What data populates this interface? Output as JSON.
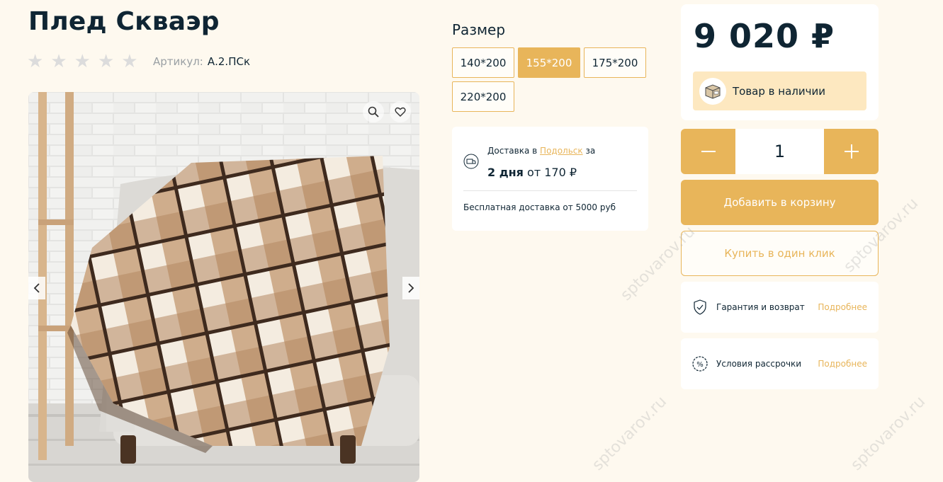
{
  "product": {
    "title": "Плед Скваэр",
    "rating_stars": 0,
    "sku_label": "Артикул:",
    "sku_value": "А.2.ПСк"
  },
  "gallery": {
    "icons": [
      "search-icon",
      "heart-icon",
      "chevron-left-icon",
      "chevron-right-icon"
    ]
  },
  "size": {
    "label": "Размер",
    "options": [
      "140*200",
      "155*200",
      "175*200",
      "220*200"
    ],
    "selected": "155*200"
  },
  "delivery": {
    "prefix": "Доставка в ",
    "city": "Подольск",
    "suffix": " за",
    "days": "2 дня",
    "from": " от 170 ₽",
    "free": "Бесплатная доставка от 5000 руб"
  },
  "price": {
    "value": "9 020 ₽",
    "stock": "Товар в наличии"
  },
  "quantity": {
    "minus": "—",
    "value": "1",
    "plus": "+"
  },
  "actions": {
    "add_to_cart": "Добавить в корзину",
    "buy_one_click": "Купить в один клик"
  },
  "info": {
    "warranty": "Гарантия и возврат",
    "installment": "Условия рассрочки",
    "more": "Подробнее"
  },
  "watermark": "sptovarov.ru",
  "colors": {
    "accent": "#e8b55a",
    "text": "#0f2533",
    "background": "#fef9ef",
    "stock_bg": "#fde8c0"
  }
}
